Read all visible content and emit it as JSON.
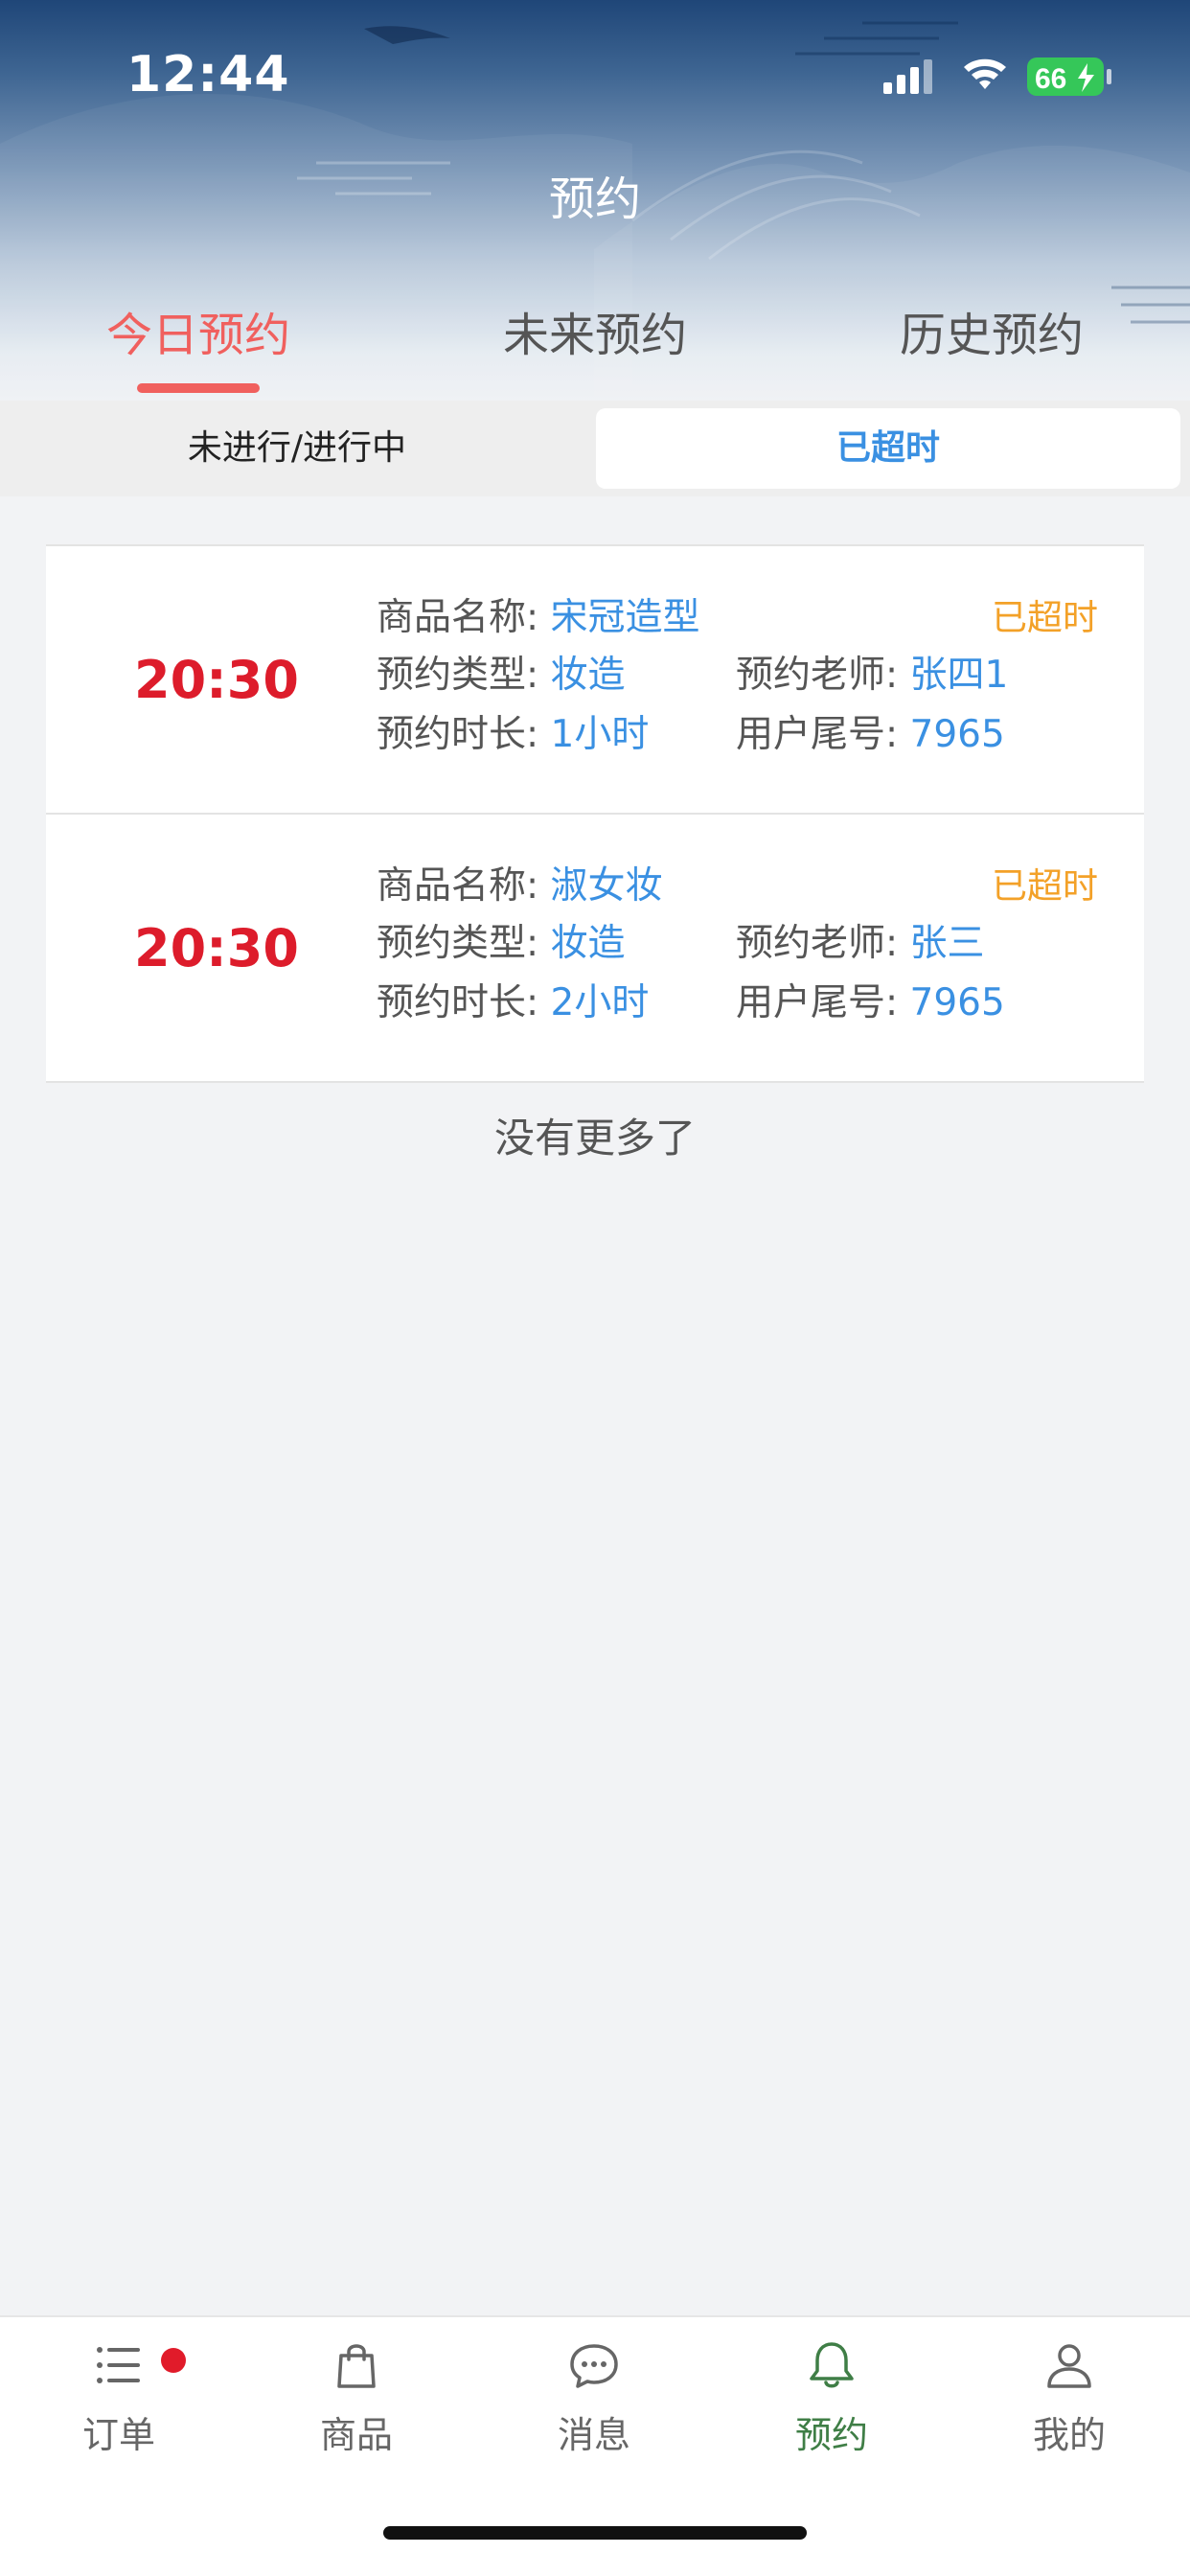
{
  "status_bar": {
    "time": "12:44",
    "battery": "66"
  },
  "header": {
    "title": "预约"
  },
  "tabs": [
    {
      "label": "今日预约",
      "active": true
    },
    {
      "label": "未来预约",
      "active": false
    },
    {
      "label": "历史预约",
      "active": false
    }
  ],
  "segment": [
    {
      "label": "未进行/进行中",
      "active": false
    },
    {
      "label": "已超时",
      "active": true
    }
  ],
  "labels": {
    "product_name": "商品名称:",
    "type": "预约类型:",
    "teacher": "预约老师:",
    "duration": "预约时长:",
    "user_tail": "用户尾号:"
  },
  "appointments": [
    {
      "time": "20:30",
      "product_name": "宋冠造型",
      "status": "已超时",
      "type": "妆造",
      "teacher": "张四1",
      "duration": "1小时",
      "user_tail": "7965"
    },
    {
      "time": "20:30",
      "product_name": "淑女妆",
      "status": "已超时",
      "type": "妆造",
      "teacher": "张三",
      "duration": "2小时",
      "user_tail": "7965"
    }
  ],
  "list_footer": "没有更多了",
  "bottom_nav": [
    {
      "label": "订单",
      "icon": "list-icon",
      "badge": true
    },
    {
      "label": "商品",
      "icon": "bag-icon",
      "badge": false
    },
    {
      "label": "消息",
      "icon": "chat-bubble-icon",
      "badge": false
    },
    {
      "label": "预约",
      "icon": "bell-icon",
      "badge": false,
      "active": true
    },
    {
      "label": "我的",
      "icon": "user-icon",
      "badge": false
    }
  ],
  "colors": {
    "accent_red": "#f0605e",
    "time_red": "#dd1c2b",
    "link_blue": "#3a90e2",
    "status_orange": "#f3a128",
    "nav_active_green": "#3f7e46"
  }
}
